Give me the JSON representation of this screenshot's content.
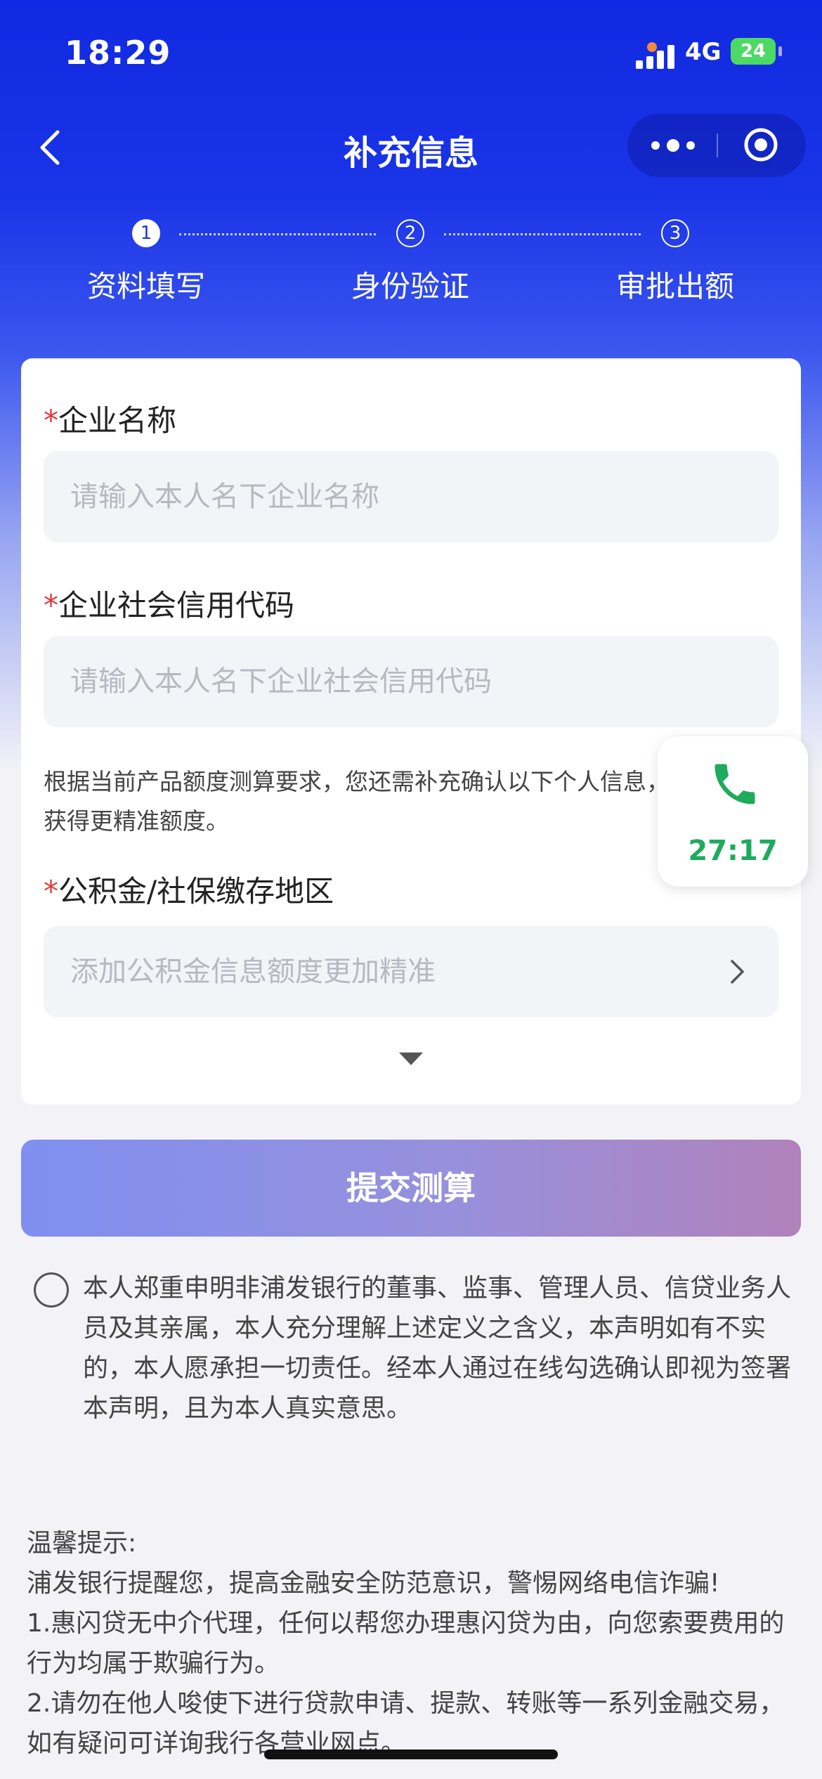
{
  "status_bar": {
    "time": "18:29",
    "network": "4G",
    "battery": "24"
  },
  "nav": {
    "title": "补充信息"
  },
  "steps": [
    {
      "number": "1",
      "label": "资料填写",
      "active": true
    },
    {
      "number": "2",
      "label": "身份验证",
      "active": false
    },
    {
      "number": "3",
      "label": "审批出额",
      "active": false
    }
  ],
  "form": {
    "required_mark": "*",
    "company_name": {
      "label": "企业名称",
      "placeholder": "请输入本人名下企业名称"
    },
    "credit_code": {
      "label": "企业社会信用代码",
      "placeholder": "请输入本人名下企业社会信用代码"
    },
    "hint": "根据当前产品额度测算要求，您还需补充确认以下个人信息，获得更精准额度。",
    "region": {
      "label": "公积金/社保缴存地区",
      "placeholder": "添加公积金信息额度更加精准"
    }
  },
  "call_widget": {
    "timer": "27:17",
    "icon": "phone-icon",
    "color": "#1faa5c"
  },
  "submit_label": "提交测算",
  "consent_text": "本人郑重申明非浦发银行的董事、监事、管理人员、信贷业务人员及其亲属，本人充分理解上述定义之含义，本声明如有不实的，本人愿承担一切责任。经本人通过在线勾选确认即视为签署本声明，且为本人真实意思。",
  "tips": {
    "title": "温馨提示:",
    "lines": [
      "浦发银行提醒您，提高金融安全防范意识，警惕网络电信诈骗!",
      "1.惠闪贷无中介代理，任何以帮您办理惠闪贷为由，向您索要费用的行为均属于欺骗行为。",
      "2.请勿在他人唆使下进行贷款申请、提款、转账等一系列金融交易，如有疑问可详询我行各营业网点。"
    ]
  },
  "colors": {
    "brand_blue": "#1a34e8",
    "required_red": "#e4393c"
  }
}
